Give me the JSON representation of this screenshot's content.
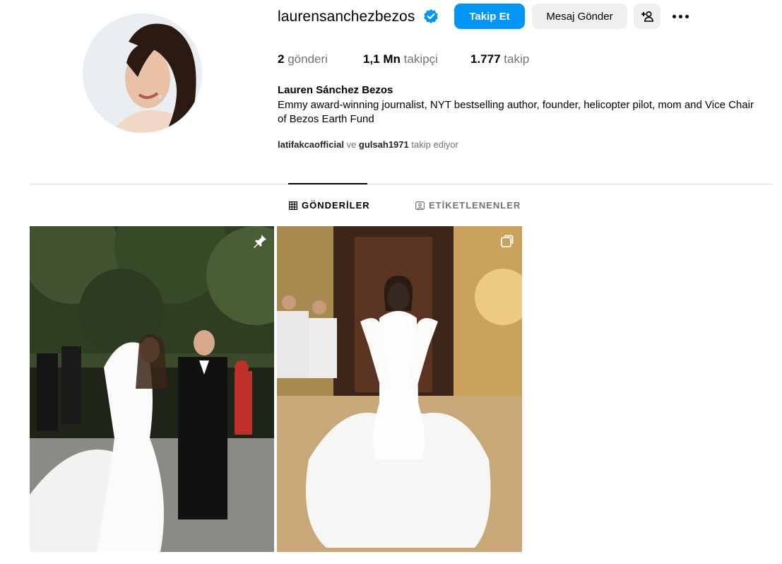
{
  "profile": {
    "username": "laurensanchezbezos",
    "full_name": "Lauren Sánchez Bezos",
    "bio": "Emmy award-winning journalist, NYT bestselling author, founder, helicopter pilot, mom and Vice Chair of Bezos Earth Fund",
    "verified": true
  },
  "actions": {
    "follow_label": "Takip Et",
    "message_label": "Mesaj Gönder",
    "suggest_label": "+person-icon",
    "more_label": "more-icon"
  },
  "stats": {
    "posts_count": "2",
    "posts_label": "gönderi",
    "followers_count": "1,1 Mn",
    "followers_label": "takipçi",
    "following_count": "1.777",
    "following_label": "takip"
  },
  "followed_by": {
    "user1": "latifakcaofficial",
    "joiner": "ve",
    "user2": "gulsah1971",
    "suffix": "takip ediyor"
  },
  "tabs": [
    {
      "label": "GÖNDERİLER",
      "icon": "grid-icon",
      "active": true
    },
    {
      "label": "ETİKETLENENLER",
      "icon": "tagged-icon",
      "active": false
    }
  ],
  "posts": [
    {
      "badge": "pin-icon"
    },
    {
      "badge": "carousel-icon"
    }
  ],
  "colors": {
    "primary_button": "#0095f6",
    "secondary_button": "#efefef",
    "muted_text": "#737373",
    "divider": "#dbdbdb",
    "verified_badge": "#0095f6"
  }
}
